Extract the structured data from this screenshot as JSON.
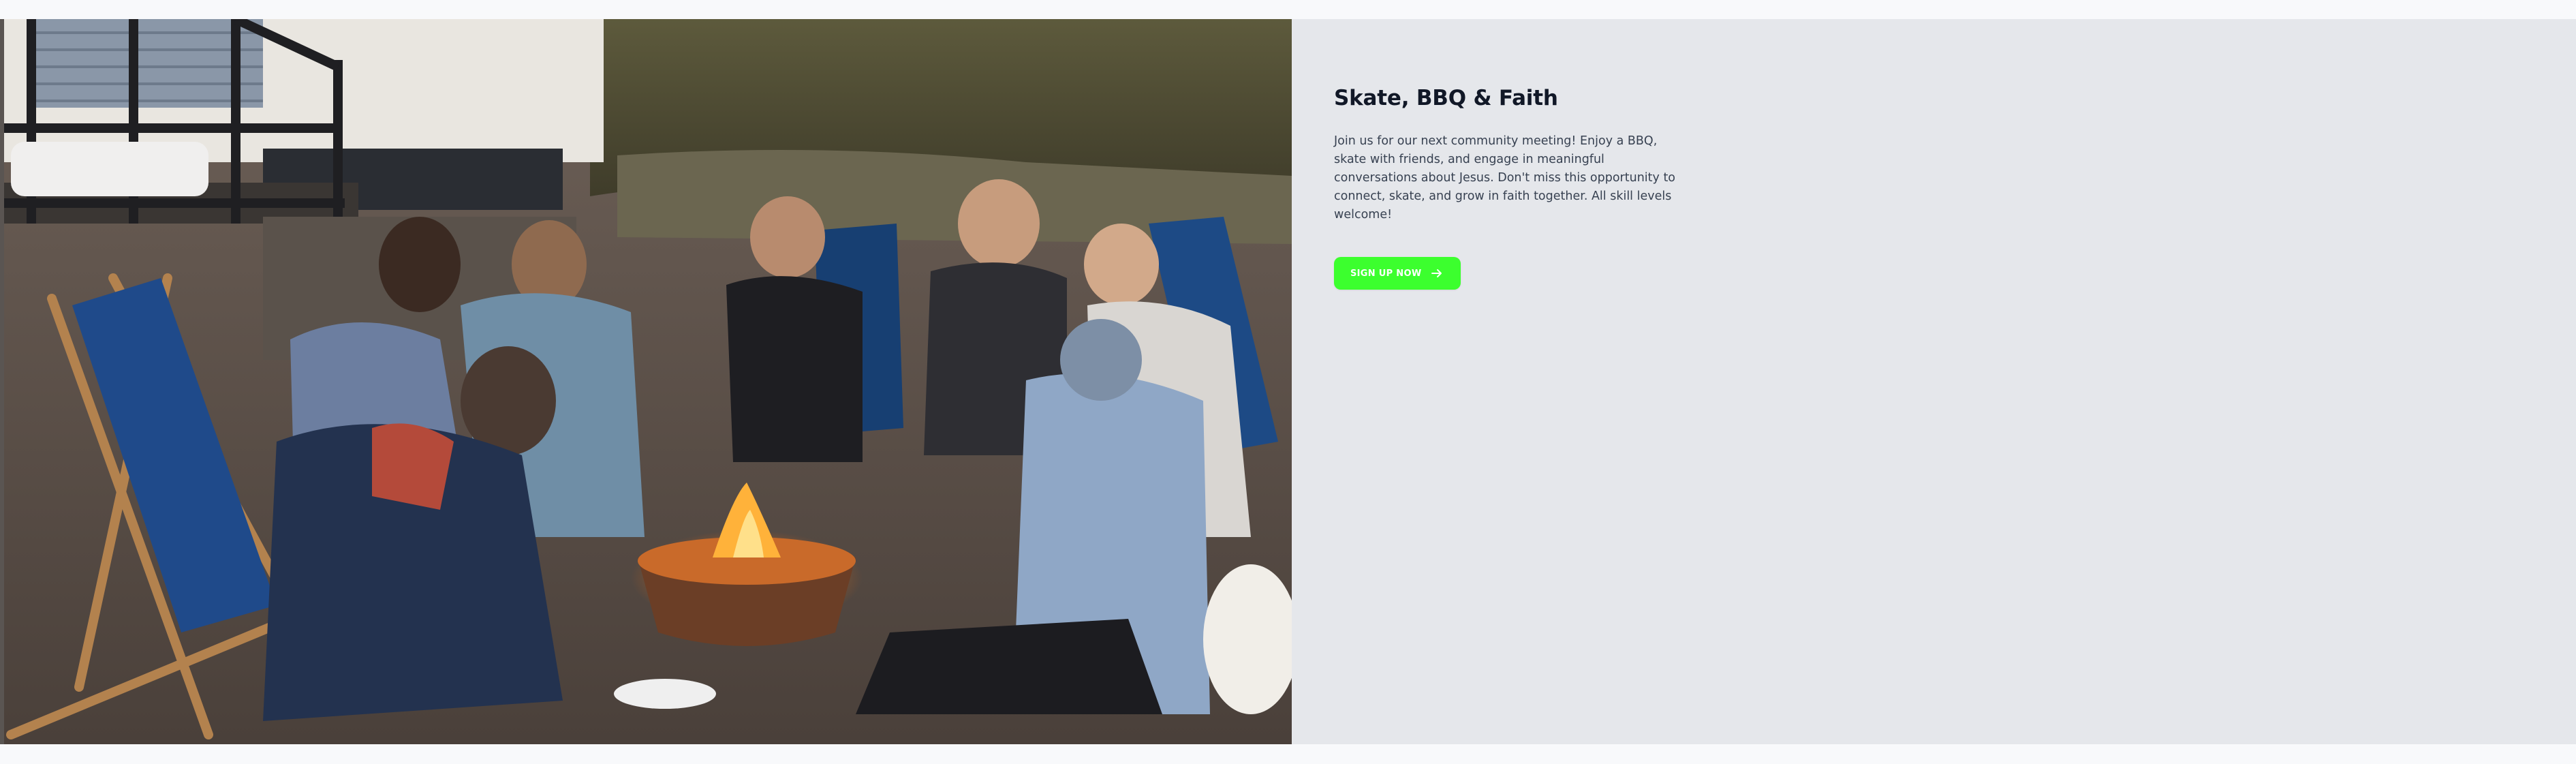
{
  "event": {
    "title": "Skate, BBQ & Faith",
    "description": "Join us for our next community meeting! Enjoy a BBQ, skate with friends, and engage in meaningful conversations about Jesus. Don't miss this opportunity to connect, skate, and grow in faith together. All skill levels welcome!",
    "cta_label": "SIGN UP NOW",
    "cta_icon": "arrow-right-icon",
    "image_subject": "group-around-campfire-photo"
  },
  "colors": {
    "cta_background": "#3cff2e",
    "section_background": "#e5e7eb",
    "title_text": "#111827",
    "body_text": "#374151"
  }
}
